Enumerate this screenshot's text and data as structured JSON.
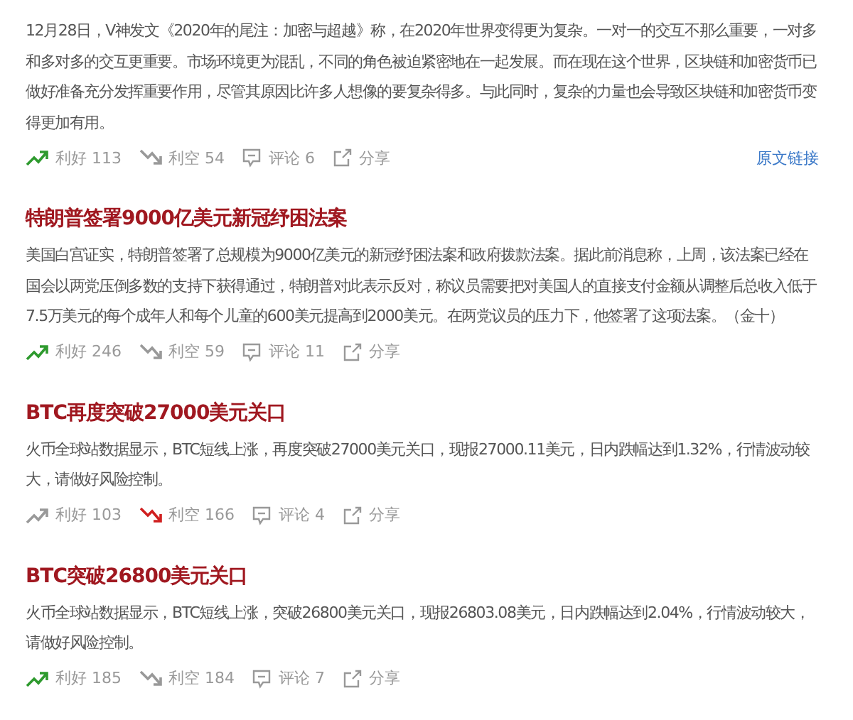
{
  "items": [
    {
      "body": "12月28日，V神发文《2020年的尾注：加密与超越》称，在2020年世界变得更为复杂。一对一的交互不那么重要，一对多和多对多的交互更重要。市场环境更为混乱，不同的角色被迫紧密地在一起发展。而在现在这个世界，区块链和加密货币已做好准备充分发挥重要作用，尽管其原因比许多人想像的要复杂得多。与此同时，复杂的力量也会导致区块链和加密货币变得更加有用。",
      "bull": {
        "label": "利好 113",
        "selected": true
      },
      "bear": {
        "label": "利空 54",
        "selected": false
      },
      "comments": "评论 6",
      "share": "分享",
      "link": "原文链接"
    },
    {
      "title": "特朗普签署9000亿美元新冠纾困法案",
      "body": "美国白宫证实，特朗普签署了总规模为9000亿美元的新冠纾困法案和政府拨款法案。据此前消息称，上周，该法案已经在国会以两党压倒多数的支持下获得通过，特朗普对此表示反对，称议员需要把对美国人的直接支付金额从调整后总收入低于7.5万美元的每个成年人和每个儿童的600美元提高到2000美元。在两党议员的压力下，他签署了这项法案。（金十）",
      "bull": {
        "label": "利好 246",
        "selected": true
      },
      "bear": {
        "label": "利空 59",
        "selected": false
      },
      "comments": "评论 11",
      "share": "分享"
    },
    {
      "title": "BTC再度突破27000美元关口",
      "body": "火币全球站数据显示，BTC短线上涨，再度突破27000美元关口，现报27000.11美元，日内跌幅达到1.32%，行情波动较大，请做好风险控制。",
      "bull": {
        "label": "利好 103",
        "selected": false
      },
      "bear": {
        "label": "利空 166",
        "selected": true
      },
      "comments": "评论 4",
      "share": "分享"
    },
    {
      "title": "BTC突破26800美元关口",
      "body": "火币全球站数据显示，BTC短线上涨，突破26800美元关口，现报26803.08美元，日内跌幅达到2.04%，行情波动较大，请做好风险控制。",
      "bull": {
        "label": "利好 185",
        "selected": true
      },
      "bear": {
        "label": "利空 184",
        "selected": false
      },
      "comments": "评论 7",
      "share": "分享"
    }
  ]
}
